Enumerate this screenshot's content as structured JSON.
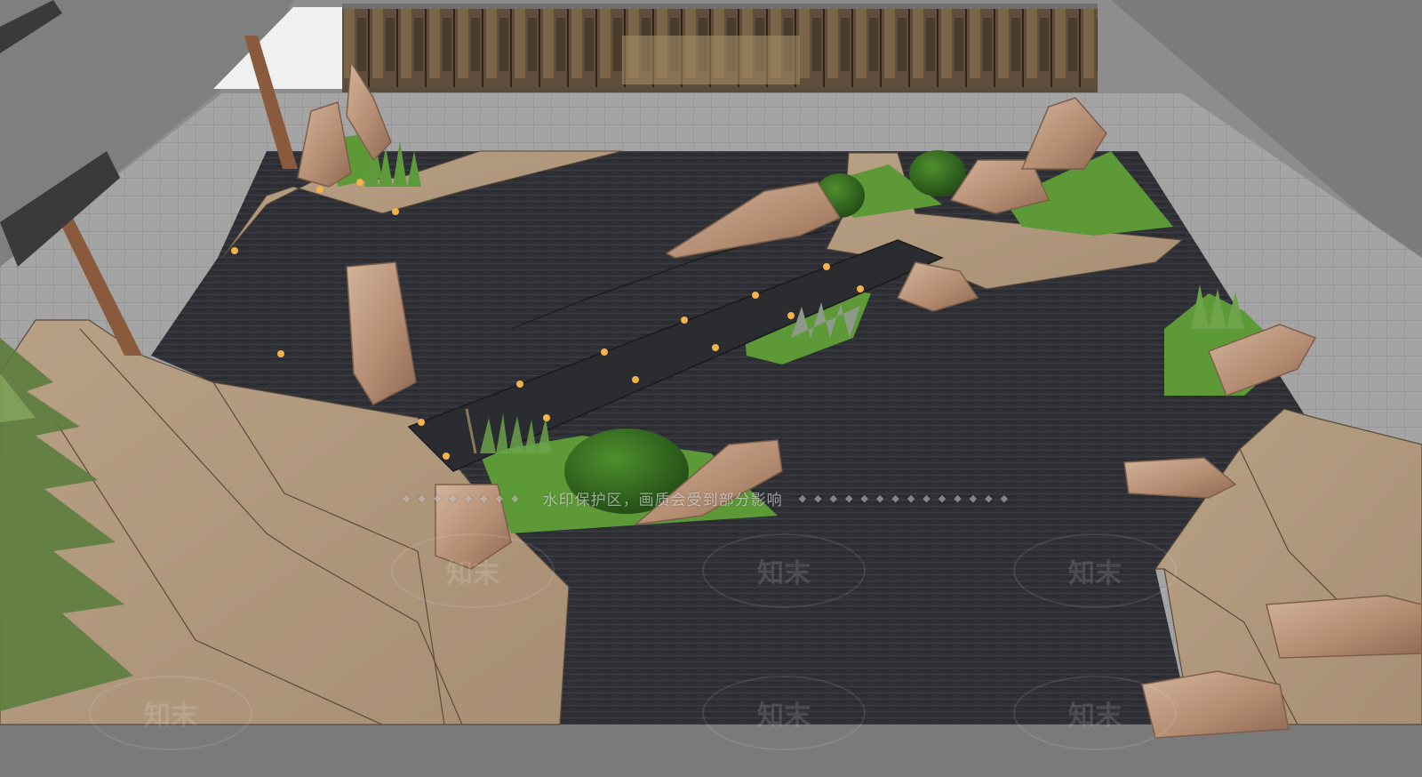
{
  "scene": {
    "subject": "courtyard-landscape-3d-model",
    "colors": {
      "background": "#8f8f8f",
      "gravel": "#323238",
      "paving": "#b39a7e",
      "lawn": "#5d9a37",
      "rock": "#b89277",
      "timber": "#8a5a3c",
      "glass": "#5a4a38",
      "bridge": "#2c2d30"
    }
  },
  "watermark": {
    "banner_text": "水印保护区，画质会受到部分影响",
    "logo_text": "知末"
  }
}
